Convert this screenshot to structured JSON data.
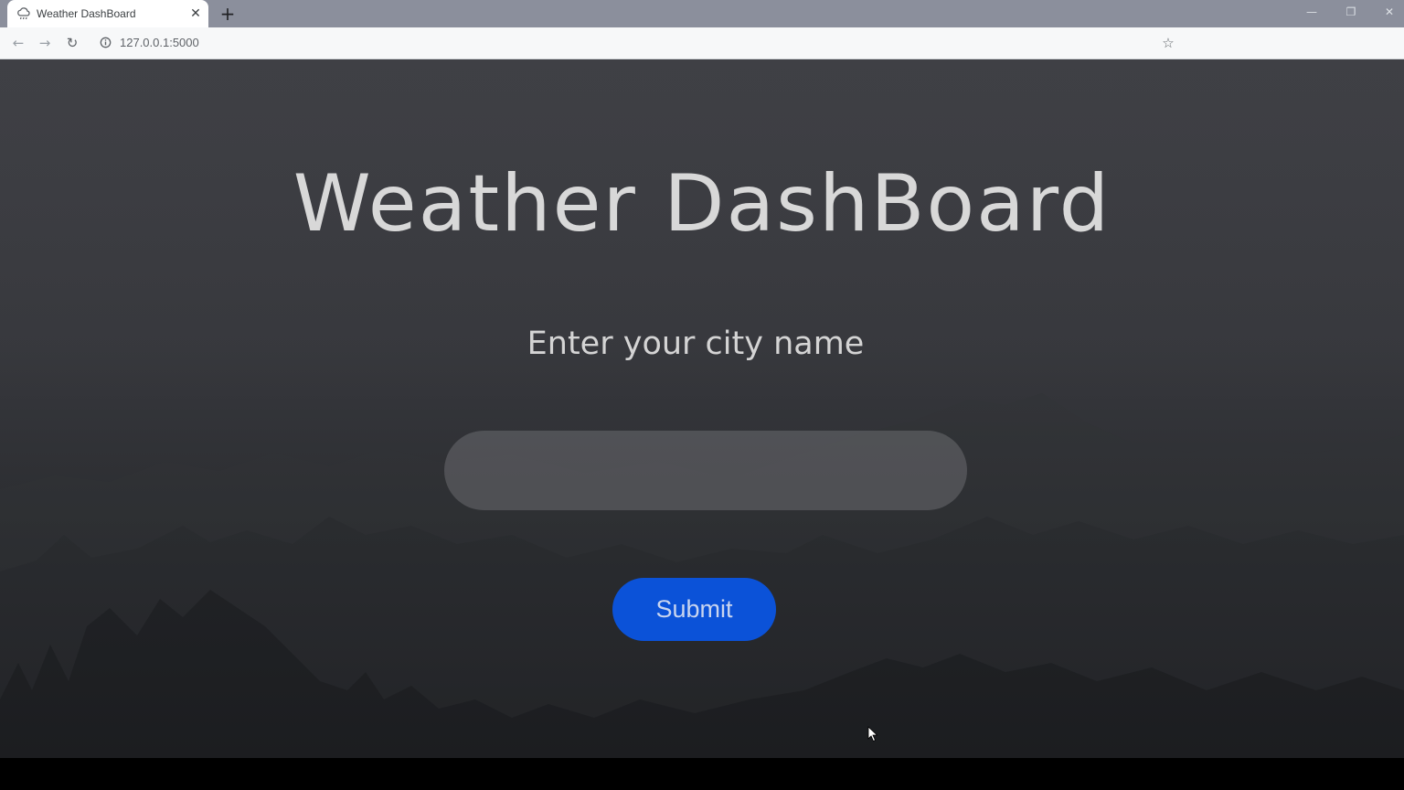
{
  "browser": {
    "tab": {
      "title": "Weather DashBoard",
      "close_glyph": "✕",
      "favicon": "cloud-rain-icon"
    },
    "new_tab_glyph": "+",
    "window_controls": {
      "minimize": "—",
      "restore": "❐",
      "close": "✕"
    },
    "toolbar": {
      "back_glyph": "←",
      "forward_glyph": "→",
      "reload_glyph": "↻",
      "url": "127.0.0.1:5000",
      "bookmark_glyph": "☆"
    }
  },
  "page": {
    "title": "Weather DashBoard",
    "prompt": "Enter your city name",
    "city_input": {
      "value": "",
      "placeholder": ""
    },
    "submit_label": "Submit"
  },
  "colors": {
    "submit_button": "#0b52d8",
    "title_text": "#d8d8d8",
    "background_top": "#3f4045",
    "background_bottom": "#1c1e21"
  }
}
